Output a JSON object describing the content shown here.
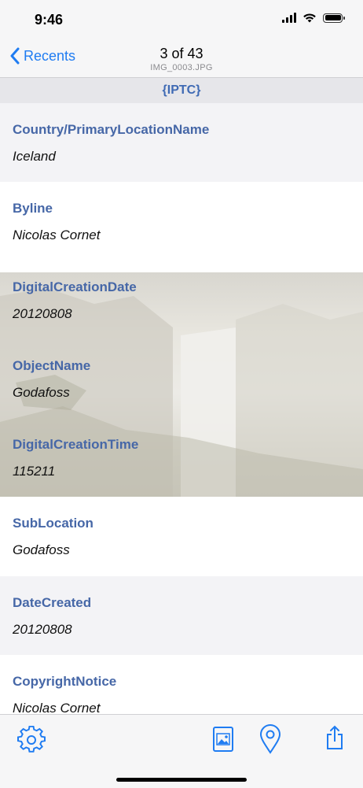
{
  "status": {
    "time": "9:46"
  },
  "nav": {
    "back_label": "Recents",
    "title": "3 of 43",
    "subtitle": "IMG_0003.JPG"
  },
  "section": {
    "title": "{IPTC}"
  },
  "rows": [
    {
      "key": "Country/PrimaryLocationName",
      "value": "Iceland"
    },
    {
      "key": "Byline",
      "value": "Nicolas Cornet"
    },
    {
      "key": "DigitalCreationDate",
      "value": "20120808"
    },
    {
      "key": "ObjectName",
      "value": "Godafoss"
    },
    {
      "key": "DigitalCreationTime",
      "value": "115211"
    },
    {
      "key": "SubLocation",
      "value": "Godafoss"
    },
    {
      "key": "DateCreated",
      "value": "20120808"
    },
    {
      "key": "CopyrightNotice",
      "value": "Nicolas Cornet"
    }
  ],
  "toolbar": {
    "icons": [
      "gear-icon",
      "photo-icon",
      "location-pin-icon",
      "share-icon"
    ]
  },
  "colors": {
    "accent": "#1f7cf2",
    "key_text": "#4667a7",
    "section_text": "#3f6ab4"
  }
}
